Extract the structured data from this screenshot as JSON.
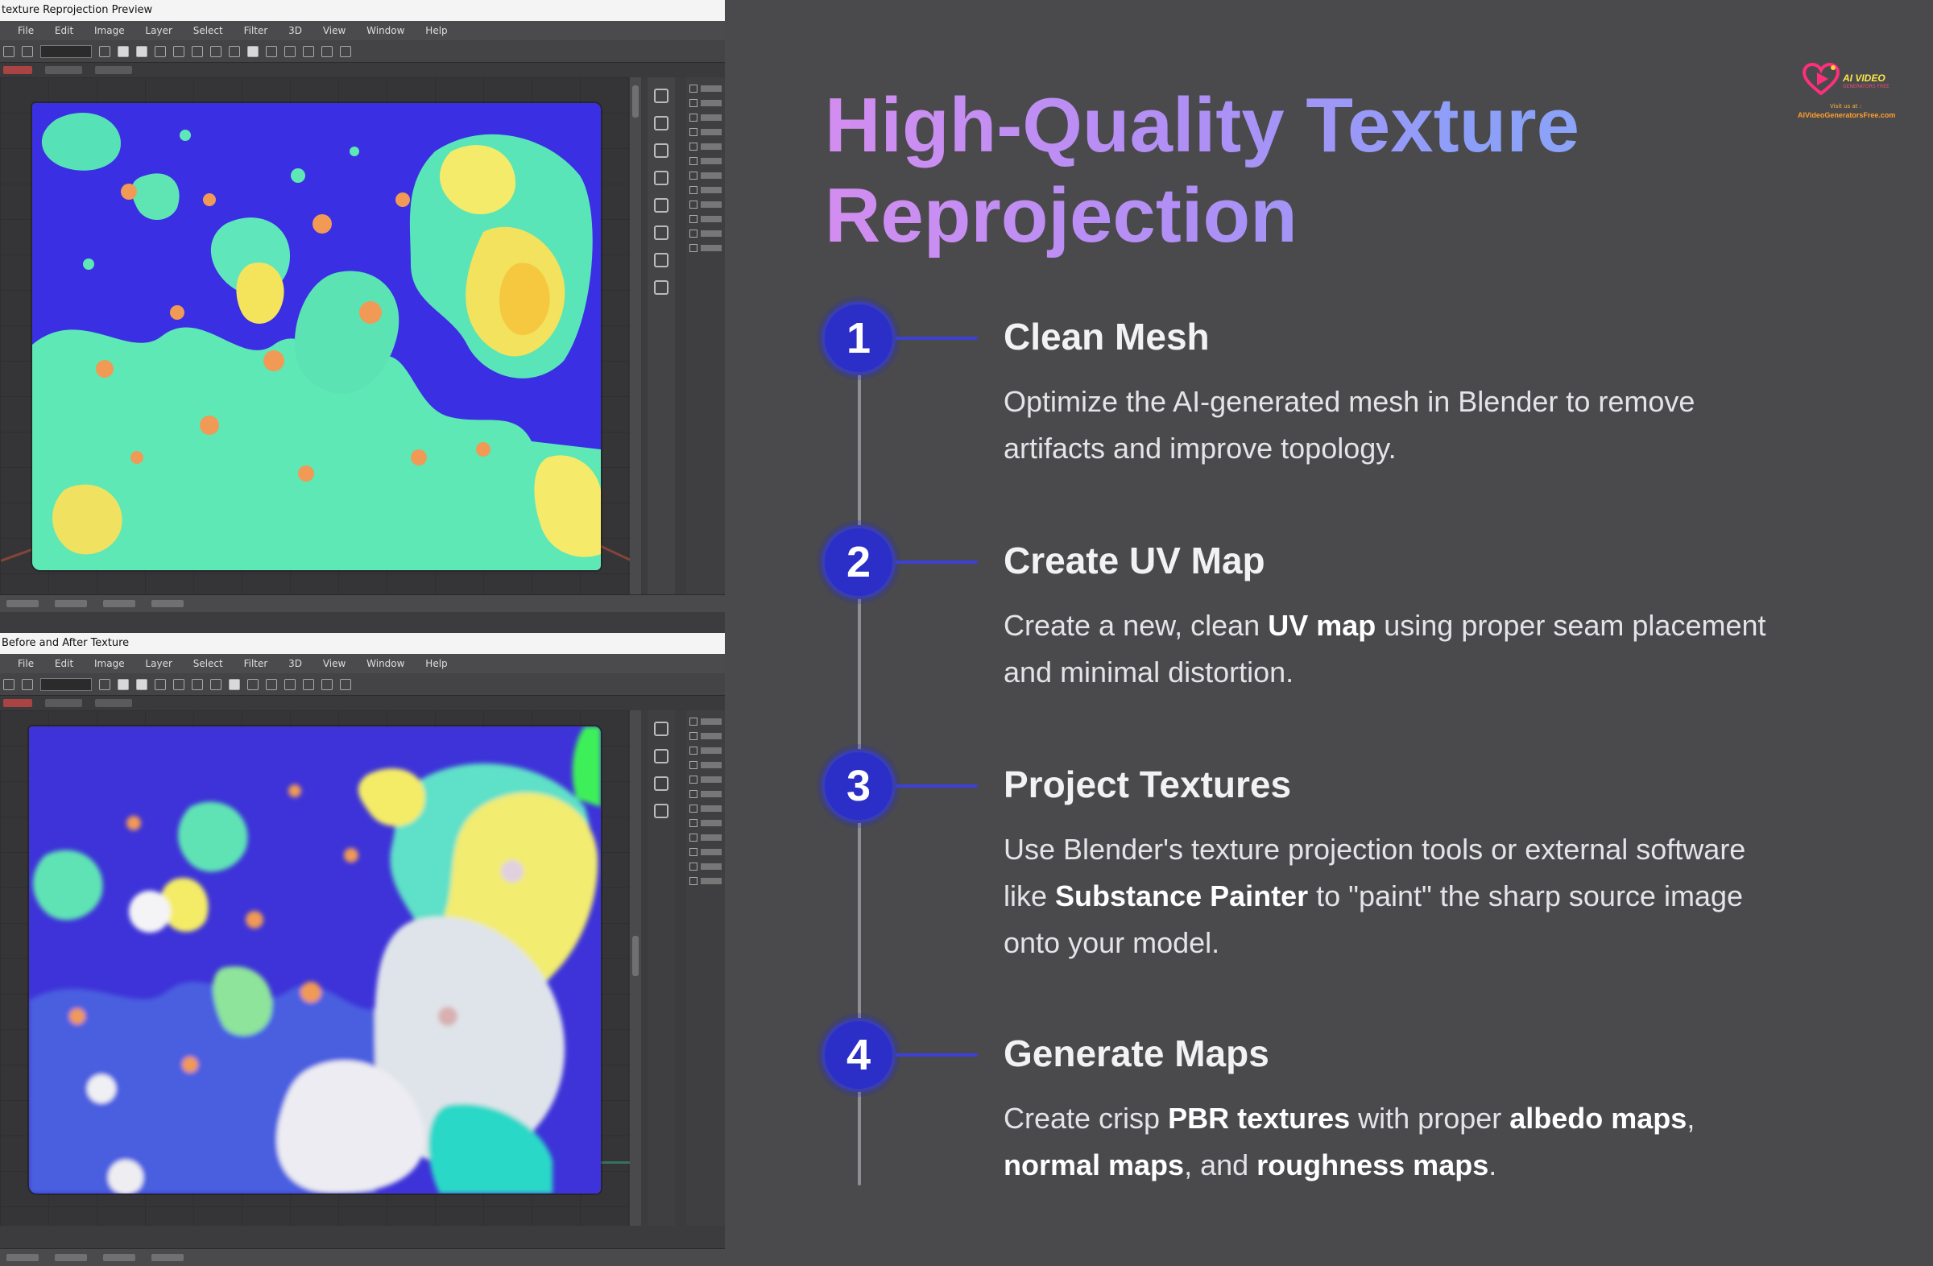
{
  "title": {
    "line1": "High-Quality Texture",
    "line2": "Reprojection"
  },
  "logo": {
    "name": "AI VIDEO",
    "sub": "GENERATORS FREE",
    "visit": "Visit us at :",
    "url": "AIVideoGeneratorsFree.com"
  },
  "screenshots": {
    "top": {
      "window_title": "texture Reprojection Preview",
      "menu": [
        "File",
        "Edit",
        "Image",
        "Layer",
        "Select",
        "Filter",
        "3D",
        "View",
        "Window",
        "Help"
      ]
    },
    "bottom": {
      "window_title": "Before and After Texture",
      "menu": [
        "File",
        "Edit",
        "Image",
        "Layer",
        "Select",
        "Filter",
        "3D",
        "View",
        "Window",
        "Help"
      ]
    }
  },
  "steps": [
    {
      "number": "1",
      "title": "Clean Mesh",
      "desc": [
        {
          "t": "Optimize the AI-generated mesh in Blender to remove artifacts and improve topology.",
          "b": false
        }
      ]
    },
    {
      "number": "2",
      "title": "Create UV Map",
      "desc": [
        {
          "t": "Create a new, clean ",
          "b": false
        },
        {
          "t": "UV map",
          "b": true
        },
        {
          "t": " using proper seam placement and minimal distortion.",
          "b": false
        }
      ]
    },
    {
      "number": "3",
      "title": "Project Textures",
      "desc": [
        {
          "t": "Use Blender's texture projection tools or external software like ",
          "b": false
        },
        {
          "t": "Substance Painter",
          "b": true
        },
        {
          "t": " to \"paint\" the sharp source image onto your model.",
          "b": false
        }
      ]
    },
    {
      "number": "4",
      "title": "Generate Maps",
      "desc": [
        {
          "t": "Create crisp ",
          "b": false
        },
        {
          "t": "PBR textures",
          "b": true
        },
        {
          "t": " with proper ",
          "b": false
        },
        {
          "t": "albedo maps",
          "b": true
        },
        {
          "t": ", ",
          "b": false
        },
        {
          "t": "normal maps",
          "b": true
        },
        {
          "t": ", and ",
          "b": false
        },
        {
          "t": "roughness maps",
          "b": true
        },
        {
          "t": ".",
          "b": false
        }
      ]
    }
  ],
  "colors": {
    "background": "#4a4a4c",
    "step_circle": "#2b2fc7",
    "connector": "#3c40d4",
    "title_gradient_start": "#d38df0",
    "title_gradient_end": "#8aa5f7"
  }
}
